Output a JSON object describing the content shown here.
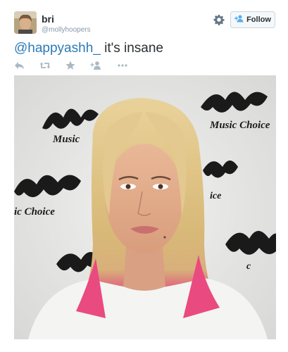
{
  "tweet": {
    "user": {
      "name": "bri",
      "handle": "@mollyhoopers"
    },
    "follow_label": "Follow",
    "text_mention": "@happyashh_",
    "text_body": " it's insane"
  },
  "actions": [
    "reply-icon",
    "retweet-icon",
    "favorite-icon",
    "follow-user-icon",
    "more-icon"
  ],
  "photo": {
    "backdrop_texts": [
      "Music Choice",
      "Music",
      "Music Choice",
      "ic Choice"
    ],
    "backdrop_logo": "mc"
  },
  "colors": {
    "link": "#2b7bb9",
    "text": "#292f33",
    "muted": "#8899a6",
    "icon": "#aab8c2"
  }
}
